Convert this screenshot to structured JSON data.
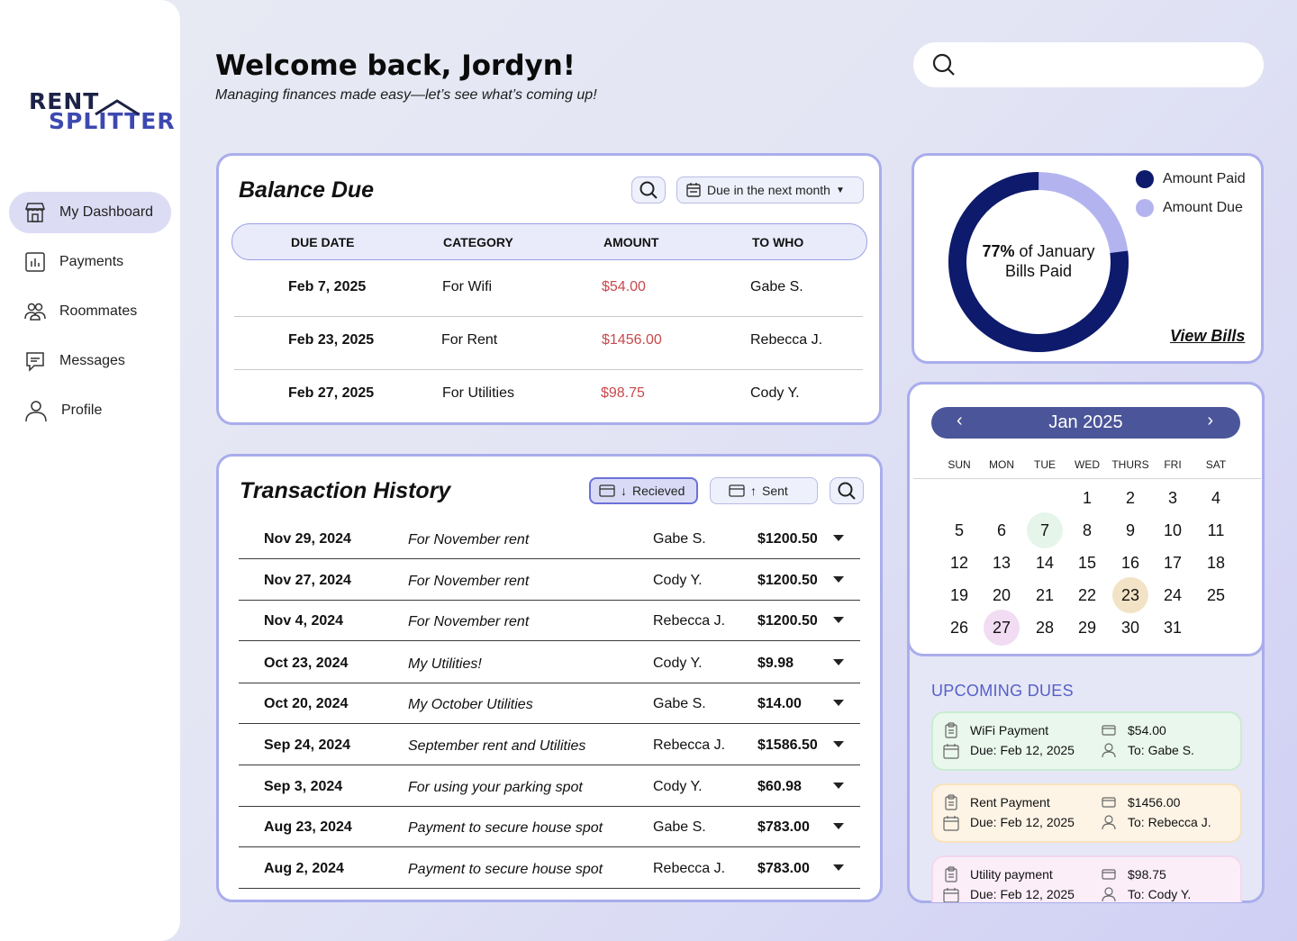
{
  "sidebar": {
    "logo_line1": "RENT",
    "logo_line2": "SPLITTER",
    "items": [
      {
        "label": "My Dashboard",
        "icon": "store-icon",
        "active": true
      },
      {
        "label": "Payments",
        "icon": "bar-chart-icon"
      },
      {
        "label": "Roommates",
        "icon": "users-icon"
      },
      {
        "label": "Messages",
        "icon": "message-icon"
      },
      {
        "label": "Profile",
        "icon": "user-icon"
      }
    ]
  },
  "header": {
    "welcome": "Welcome back, Jordyn!",
    "subtitle": "Managing finances made easy—let’s see what’s coming up!",
    "search_placeholder": ""
  },
  "balance_due": {
    "title": "Balance Due",
    "filter_label": "Due in the next month",
    "columns": [
      "DUE DATE",
      "CATEGORY",
      "AMOUNT",
      "TO WHO"
    ],
    "rows": [
      {
        "date": "Feb 7, 2025",
        "category": "For Wifi",
        "amount": "$54.00",
        "to": "Gabe S."
      },
      {
        "date": "Feb 23, 2025",
        "category": "For Rent",
        "amount": "$1456.00",
        "to": "Rebecca J."
      },
      {
        "date": "Feb 27, 2025",
        "category": "For Utilities",
        "amount": "$98.75",
        "to": "Cody Y."
      }
    ]
  },
  "transactions": {
    "title": "Transaction History",
    "tab_received": "Recieved",
    "tab_sent": "Sent",
    "rows": [
      {
        "date": "Nov 29, 2024",
        "desc": "For November rent",
        "who": "Gabe S.",
        "amount": "$1200.50"
      },
      {
        "date": "Nov 27, 2024",
        "desc": "For November rent",
        "who": "Cody Y.",
        "amount": "$1200.50"
      },
      {
        "date": "Nov 4, 2024",
        "desc": "For November rent",
        "who": "Rebecca J.",
        "amount": "$1200.50"
      },
      {
        "date": "Oct 23, 2024",
        "desc": "My Utilities!",
        "who": "Cody Y.",
        "amount": "$9.98"
      },
      {
        "date": "Oct 20, 2024",
        "desc": "My October Utilities",
        "who": "Gabe S.",
        "amount": "$14.00"
      },
      {
        "date": "Sep 24, 2024",
        "desc": "September rent and Utilities",
        "who": "Rebecca J.",
        "amount": "$1586.50"
      },
      {
        "date": "Sep 3, 2024",
        "desc": "For using your parking spot",
        "who": "Cody Y.",
        "amount": "$60.98"
      },
      {
        "date": "Aug 23, 2024",
        "desc": "Payment to secure house spot",
        "who": "Gabe S.",
        "amount": "$783.00"
      },
      {
        "date": "Aug 2, 2024",
        "desc": "Payment to secure house spot",
        "who": "Rebecca J.",
        "amount": "$783.00"
      }
    ]
  },
  "bills_chart": {
    "center_bold": "77%",
    "center_rest": " of January",
    "center_line2": "Bills Paid",
    "legend_paid": "Amount Paid",
    "legend_due": "Amount Due",
    "view_bills": "View Bills",
    "paid_fraction": 0.77,
    "color_paid": "#0e1a6b",
    "color_due": "#b3b4ef"
  },
  "calendar": {
    "month_label": "Jan 2025",
    "weekdays": [
      "SUN",
      "MON",
      "TUE",
      "WED",
      "THURS",
      "FRI",
      "SAT"
    ],
    "first_weekday": 3,
    "days_in_month": 31,
    "highlights": [
      {
        "day": 7,
        "color": "#e6f5ea"
      },
      {
        "day": 23,
        "color": "#f3e3c6"
      },
      {
        "day": 27,
        "color": "#f1dcf3"
      }
    ]
  },
  "upcoming": {
    "title": "UPCOMING DUES",
    "items": [
      {
        "name": "WiFi Payment",
        "due": "Due: Feb 12, 2025",
        "amount": "$54.00",
        "to": "To: Gabe S.",
        "bg": "#e9f7ec",
        "border": "#c9ecd2"
      },
      {
        "name": "Rent Payment",
        "due": "Due: Feb 12, 2025",
        "amount": "$1456.00",
        "to": "To: Rebecca J.",
        "bg": "#fdf4e6",
        "border": "#f7e2bd"
      },
      {
        "name": "Utility payment",
        "due": "Due: Feb 12, 2025",
        "amount": "$98.75",
        "to": "To: Cody Y.",
        "bg": "#fbeef8",
        "border": "#f4d7ee"
      }
    ]
  }
}
